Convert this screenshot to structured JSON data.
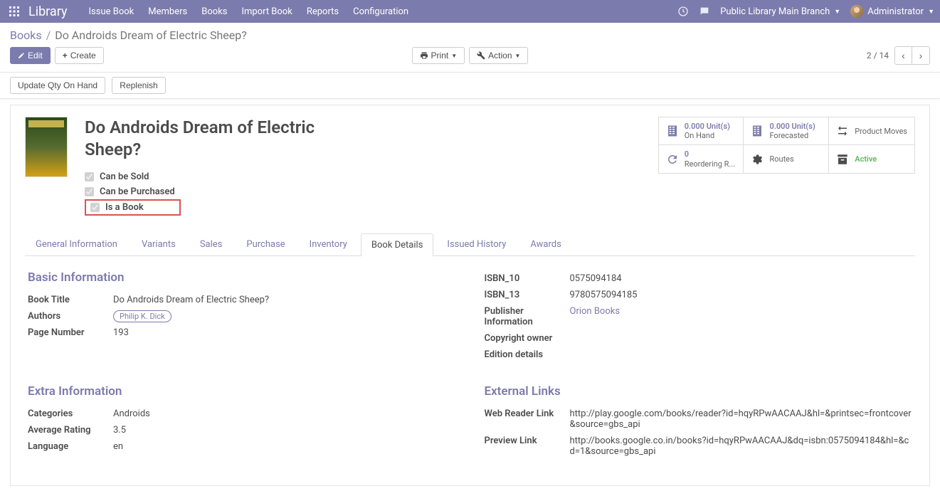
{
  "brand": "Library",
  "menu": [
    "Issue Book",
    "Members",
    "Books",
    "Import Book",
    "Reports",
    "Configuration"
  ],
  "company": "Public Library Main Branch",
  "user": "Administrator",
  "breadcrumb": {
    "root": "Books",
    "current": "Do Androids Dream of Electric Sheep?"
  },
  "buttons": {
    "edit": "Edit",
    "create": "Create",
    "print": "Print",
    "action": "Action",
    "update_qty": "Update Qty On Hand",
    "replenish": "Replenish"
  },
  "pager": "2 / 14",
  "title": "Do Androids Dream of Electric Sheep?",
  "checks": {
    "sold": "Can be Sold",
    "purchased": "Can be Purchased",
    "is_book": "Is a Book"
  },
  "stats": {
    "onhand": {
      "value": "0.000 Unit(s)",
      "label": "On Hand"
    },
    "forecast": {
      "value": "0.000 Unit(s)",
      "label": "Forecasted"
    },
    "moves": {
      "label": "Product Moves"
    },
    "reorder": {
      "value": "0",
      "label": "Reordering R..."
    },
    "routes": {
      "label": "Routes"
    },
    "active": {
      "label": "Active"
    }
  },
  "tabs": [
    "General Information",
    "Variants",
    "Sales",
    "Purchase",
    "Inventory",
    "Book Details",
    "Issued History",
    "Awards"
  ],
  "active_tab": "Book Details",
  "sections": {
    "basic": {
      "title": "Basic Information",
      "book_title_label": "Book Title",
      "book_title": "Do Androids Dream of Electric Sheep?",
      "authors_label": "Authors",
      "author": "Philip K. Dick",
      "page_label": "Page Number",
      "pages": "193"
    },
    "isbn": {
      "isbn10_label": "ISBN_10",
      "isbn10": "0575094184",
      "isbn13_label": "ISBN_13",
      "isbn13": "9780575094185",
      "publisher_label": "Publisher Information",
      "publisher": "Orion Books",
      "copyright_label": "Copyright owner",
      "edition_label": "Edition details"
    },
    "extra": {
      "title": "Extra Information",
      "cat_label": "Categories",
      "cat": "Androids",
      "rating_label": "Average Rating",
      "rating": "3.5",
      "lang_label": "Language",
      "lang": "en"
    },
    "links": {
      "title": "External Links",
      "reader_label": "Web Reader Link",
      "reader": "http://play.google.com/books/reader?id=hqyRPwAACAAJ&hl=&printsec=frontcover&source=gbs_api",
      "preview_label": "Preview Link",
      "preview": "http://books.google.co.in/books?id=hqyRPwAACAAJ&dq=isbn:0575094184&hl=&cd=1&source=gbs_api"
    }
  }
}
